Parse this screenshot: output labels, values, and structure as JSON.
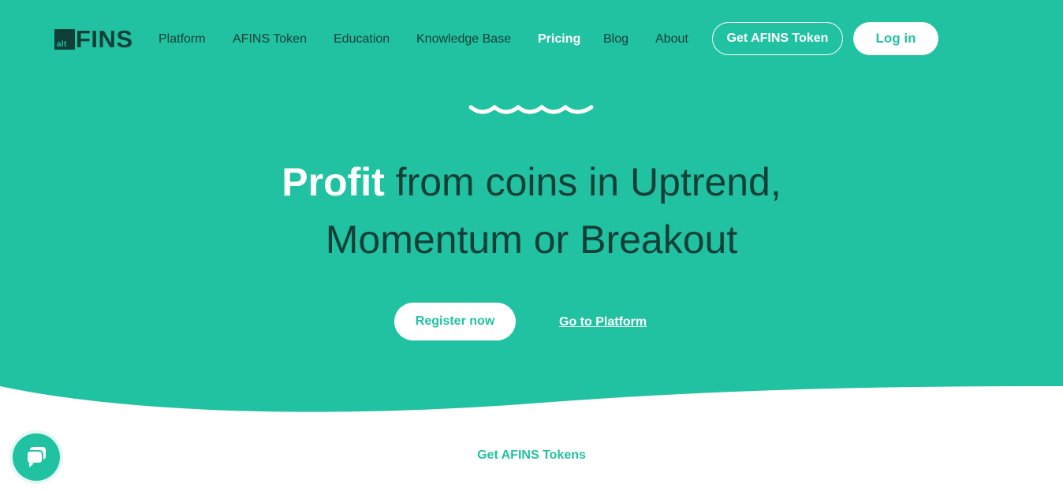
{
  "brand": {
    "logo_small": "alt",
    "logo_main": "FINS"
  },
  "nav": {
    "items": [
      {
        "label": "Platform"
      },
      {
        "label": "AFINS Token"
      },
      {
        "label": "Education"
      },
      {
        "label": "Knowledge Base"
      },
      {
        "label": "Pricing"
      },
      {
        "label": "Blog"
      },
      {
        "label": "About"
      }
    ],
    "cta_label": "Get AFINS Token",
    "login_label": "Log in"
  },
  "hero": {
    "headline_emphasis": "Profit",
    "headline_rest_line1": " from coins in Uptrend,",
    "headline_line2": "Momentum or Breakout",
    "register_label": "Register now",
    "platform_link_label": "Go to Platform"
  },
  "section": {
    "label": "Get AFINS Tokens"
  },
  "colors": {
    "accent": "#21c2a1",
    "dark": "#133f37",
    "white": "#ffffff"
  },
  "icons": {
    "wave": "wave-divider-icon",
    "chat": "chat-bubble-icon"
  }
}
